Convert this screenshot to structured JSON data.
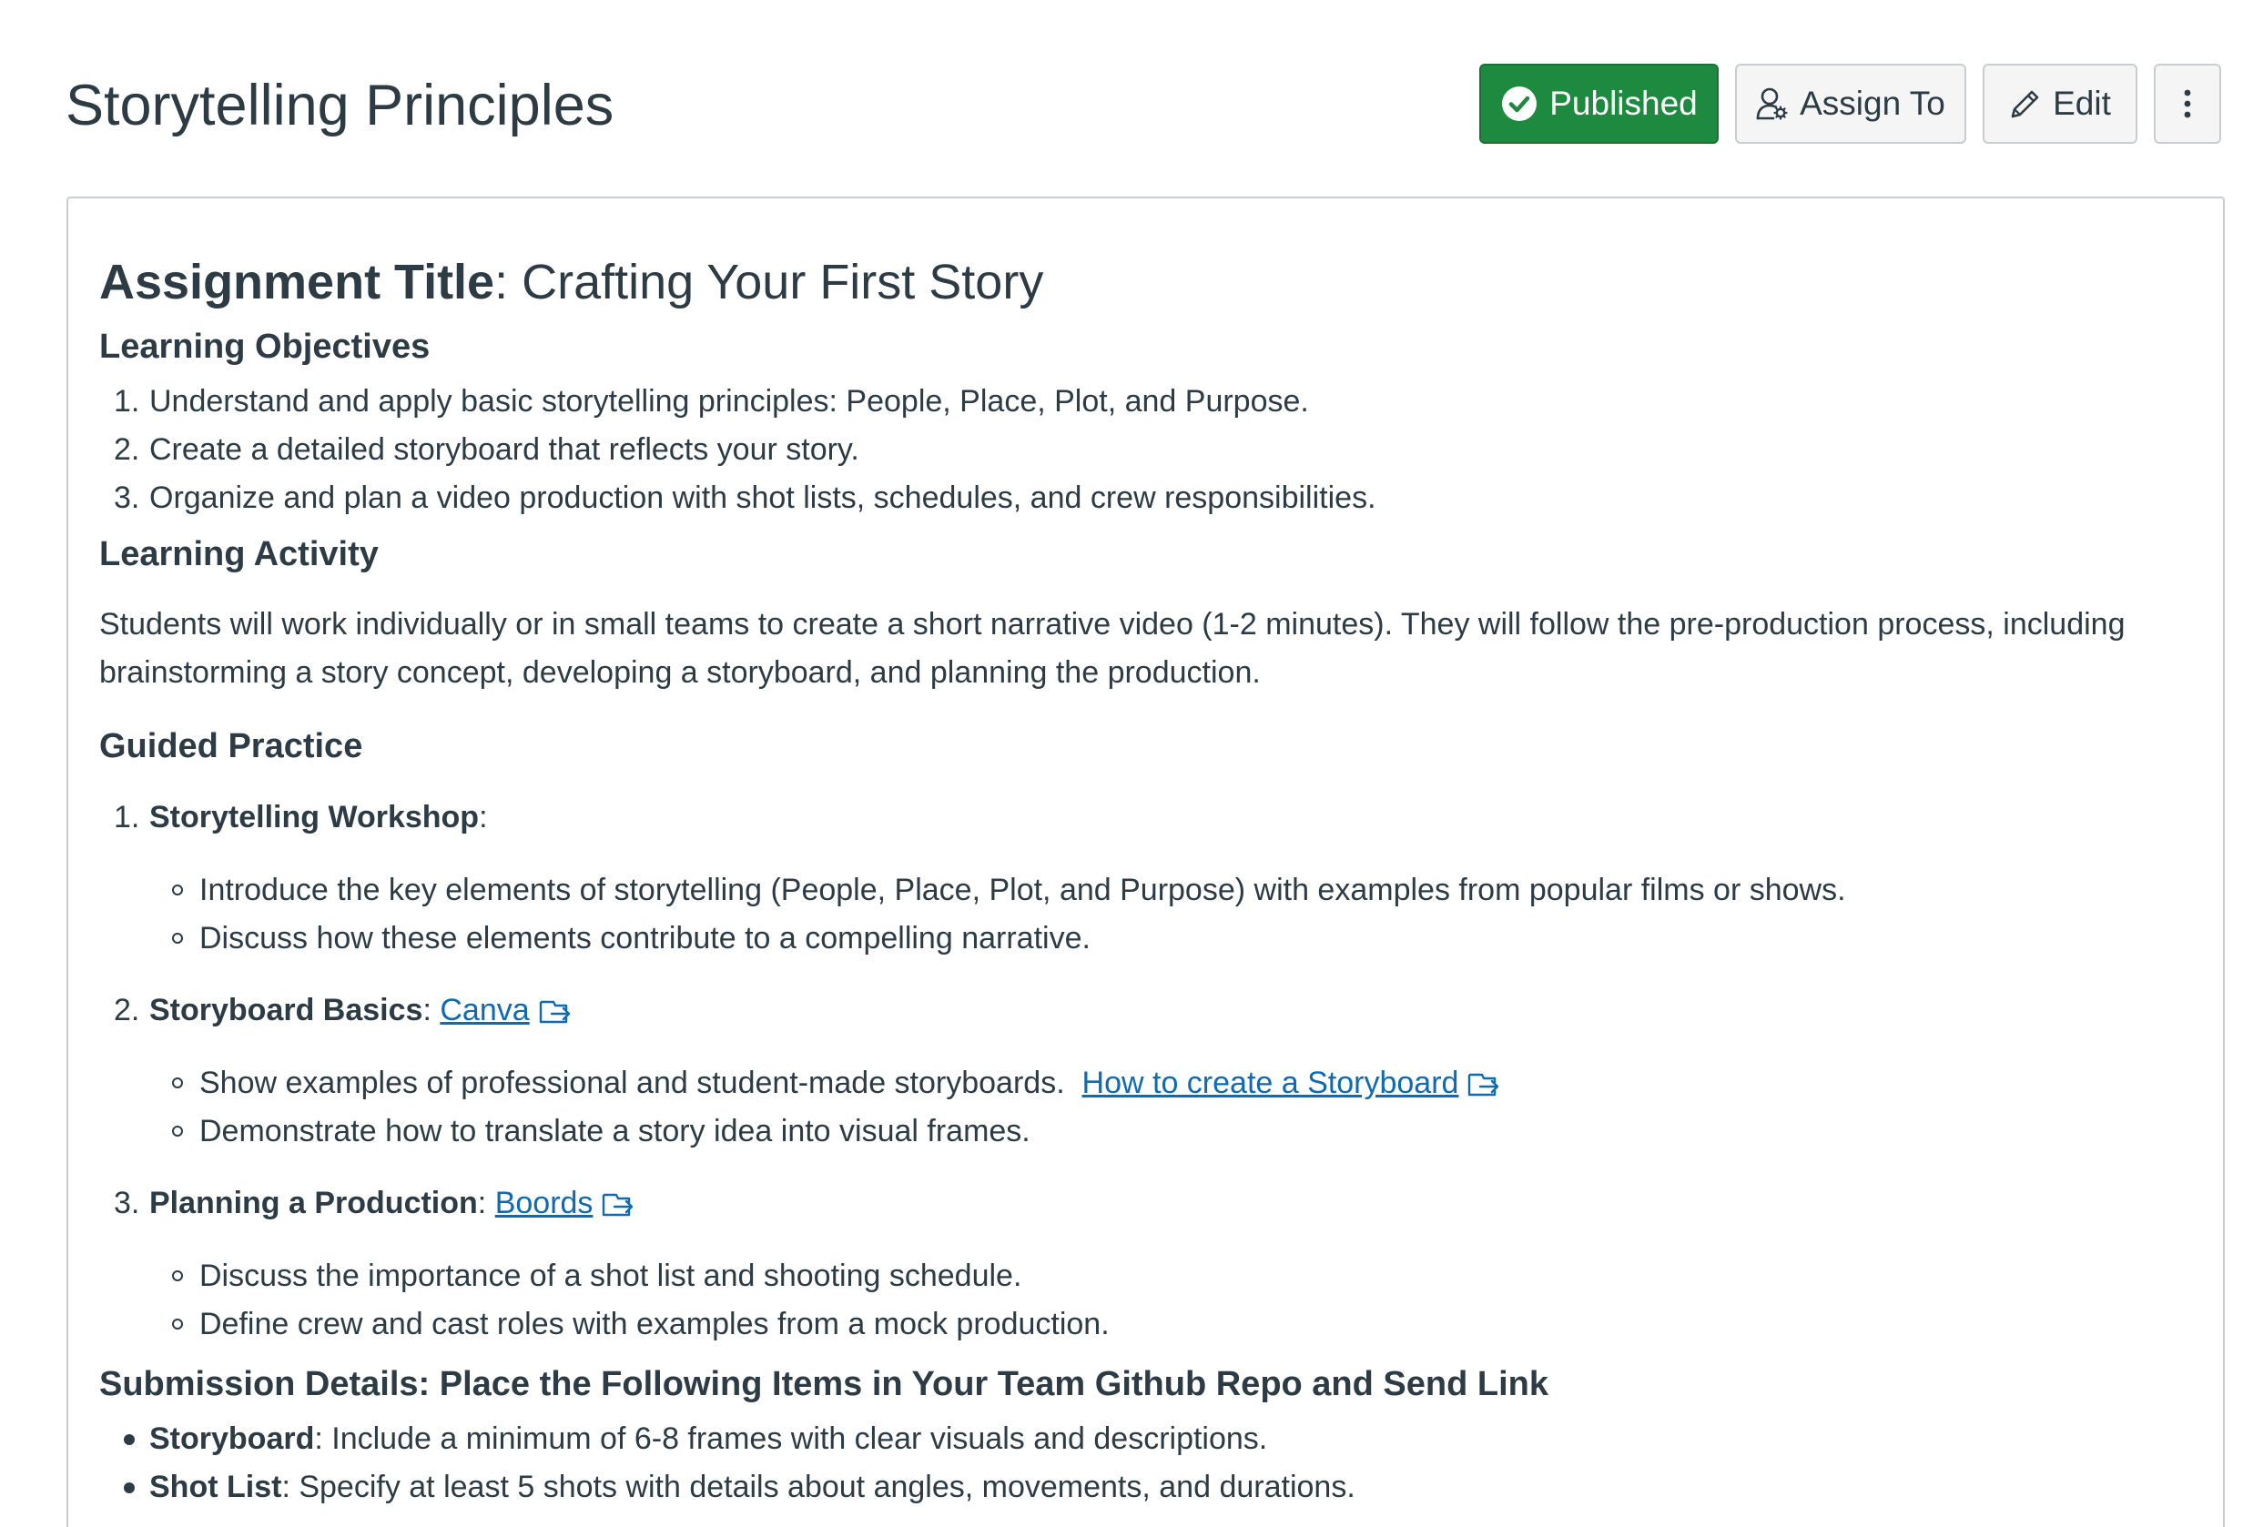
{
  "header": {
    "title": "Storytelling Principles",
    "published_label": "Published",
    "assign_label": "Assign To",
    "edit_label": "Edit"
  },
  "content": {
    "assignment_title_label": "Assignment Title",
    "assignment_title_value": ": Crafting Your First Story",
    "objectives_heading": "Learning Objectives",
    "objectives": [
      "Understand and apply basic storytelling principles: People, Place, Plot, and Purpose.",
      "Create a detailed storyboard that reflects your story.",
      "Organize and plan a video production with shot lists, schedules, and crew responsibilities."
    ],
    "activity_heading": "Learning Activity",
    "activity_text": "Students will work individually or in small teams to create a short narrative video (1-2 minutes). They will follow the pre-production process, including brainstorming a story concept, developing a storyboard, and planning the production.",
    "guided_heading": "Guided Practice",
    "guided": [
      {
        "title": "Storytelling Workshop",
        "link": "",
        "bullets": [
          {
            "text": "Introduce the key elements of storytelling (People, Place, Plot, and Purpose) with examples from popular films or shows.",
            "link": ""
          },
          {
            "text": "Discuss how these elements contribute to a compelling narrative.",
            "link": ""
          }
        ]
      },
      {
        "title": "Storyboard Basics",
        "link": "Canva",
        "bullets": [
          {
            "text": "Show examples of professional and student-made storyboards.",
            "link": "How to create a Storyboard"
          },
          {
            "text": "Demonstrate how to translate a story idea into visual frames.",
            "link": ""
          }
        ]
      },
      {
        "title": "Planning a Production",
        "link": "Boords",
        "bullets": [
          {
            "text": "Discuss the importance of a shot list and shooting schedule.",
            "link": ""
          },
          {
            "text": "Define crew and cast roles with examples from a mock production.",
            "link": ""
          }
        ]
      }
    ],
    "submission_heading": "Submission Details: Place the Following Items in Your Team Github Repo and Send Link",
    "submission_items": [
      {
        "label": "Storyboard",
        "text": ": Include a minimum of 6-8 frames with clear visuals and descriptions."
      },
      {
        "label": "Shot List",
        "text": ": Specify at least 5 shots with details about angles, movements, and durations."
      }
    ]
  },
  "colors": {
    "published_green": "#1e8a3f",
    "link_blue": "#0e6ab2",
    "text": "#2d3b45"
  }
}
